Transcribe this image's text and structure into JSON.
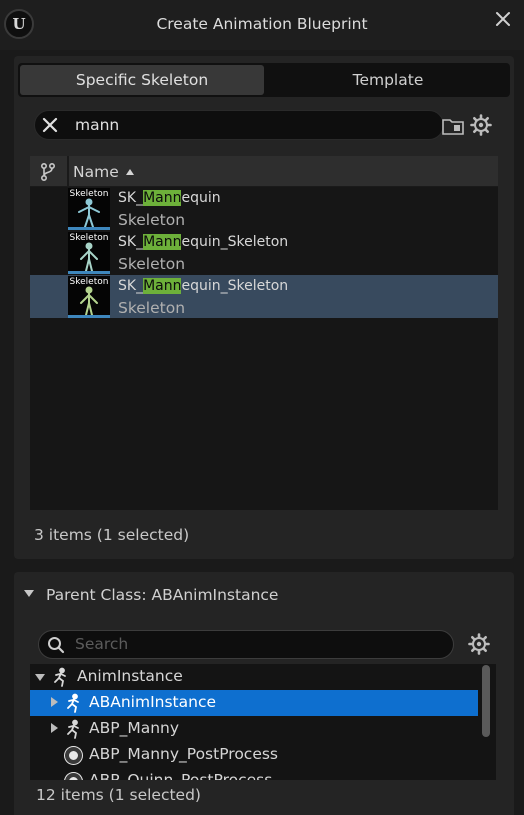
{
  "window": {
    "title": "Create Animation Blueprint",
    "logo_glyph": "U",
    "close_icon": "close-icon"
  },
  "tabs": [
    {
      "label": "Specific Skeleton",
      "active": true
    },
    {
      "label": "Template",
      "active": false
    }
  ],
  "skeleton_search": {
    "value": "mann",
    "clear_icon": "clear-x-icon",
    "folder_icon": "folder-icon",
    "settings_icon": "gear-icon"
  },
  "asset_list": {
    "column_header": "Name",
    "sort": "ascending",
    "thumb_label": "Skeleton",
    "rows": [
      {
        "name_pre": "SK_",
        "name_match": "Mann",
        "name_post": "equin",
        "type": "Skeleton",
        "selected": false
      },
      {
        "name_pre": "SK_",
        "name_match": "Mann",
        "name_post": "equin_Skeleton",
        "type": "Skeleton",
        "selected": false
      },
      {
        "name_pre": "SK_",
        "name_match": "Mann",
        "name_post": "equin_Skeleton",
        "type": "Skeleton",
        "selected": true
      }
    ],
    "count": "3 items (1 selected)"
  },
  "parent_class": {
    "header": "Parent Class: ABAnimInstance",
    "search_placeholder": "Search",
    "tree": [
      {
        "label": "AnimInstance",
        "icon": "anim-running-man-icon",
        "expander": "expanded",
        "selected": false
      },
      {
        "label": "ABAnimInstance",
        "icon": "anim-running-man-icon",
        "expander": "collapsed",
        "selected": true
      },
      {
        "label": "ABP_Manny",
        "icon": "anim-running-man-icon",
        "expander": "collapsed",
        "selected": false
      },
      {
        "label": "ABP_Manny_PostProcess",
        "icon": "circle-icon",
        "expander": "none",
        "selected": false
      },
      {
        "label": "ABP_Quinn_PostProcess",
        "icon": "circle-icon",
        "expander": "none",
        "selected": false
      }
    ],
    "count": "12 items (1 selected)"
  },
  "colors": {
    "accent_selected": "#0e6fcf",
    "row_selected": "#384a5e",
    "match_highlight": "#6db03a",
    "thumb_border": "#3e87bd"
  }
}
